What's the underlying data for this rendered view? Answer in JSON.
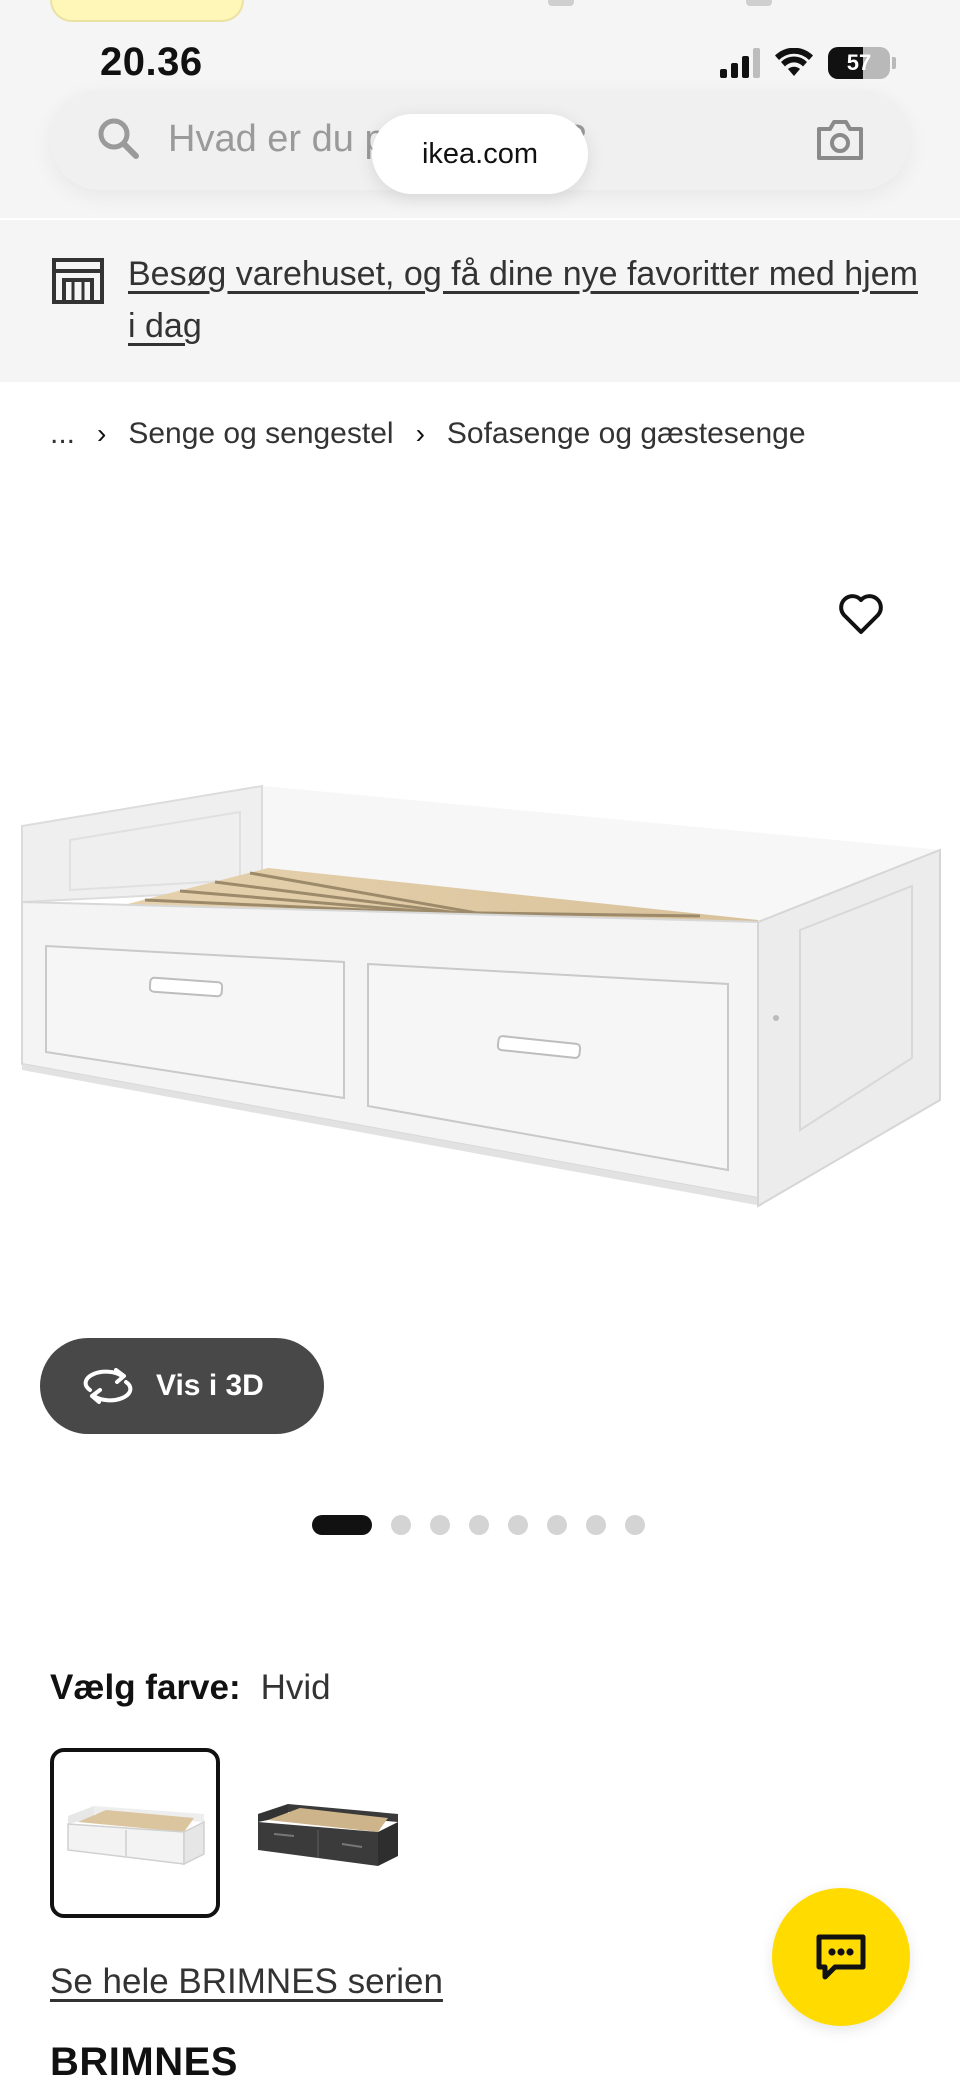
{
  "status_bar": {
    "time": "20.36",
    "battery": "57"
  },
  "search": {
    "placeholder": "Hvad er du på jagt efter?"
  },
  "browser": {
    "url": "ikea.com"
  },
  "store_banner": {
    "text": "Besøg varehuset, og få dine nye favoritter med hjem i dag"
  },
  "breadcrumb": {
    "ellipsis": "...",
    "items": [
      "Senge og sengestel",
      "Sofasenge og gæstesenge"
    ]
  },
  "viewer": {
    "button_3d": "Vis i 3D",
    "image_count": 8,
    "active_image": 1
  },
  "color_select": {
    "label": "Vælg farve:",
    "value": "Hvid",
    "options": [
      "Hvid",
      "Sort-brun"
    ]
  },
  "series_link": "Se hele BRIMNES serien",
  "product": {
    "name": "BRIMNES"
  },
  "colors": {
    "brand_yellow": "#ffdb00",
    "button_dark": "#484848",
    "banner_bg": "#f5f5f5"
  }
}
